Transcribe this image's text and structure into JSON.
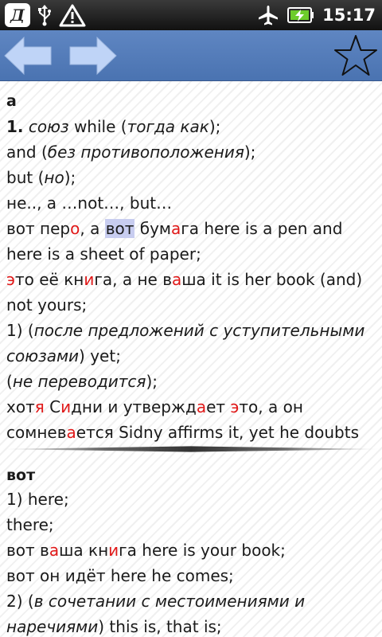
{
  "status_bar": {
    "app_badge_letter": "Д",
    "icons": [
      "usb-icon",
      "warning-icon",
      "airplane-mode-icon",
      "battery-charging-icon"
    ],
    "time": "15:17"
  },
  "toolbar": {
    "back_icon": "arrow-left-icon",
    "forward_icon": "arrow-right-icon",
    "favorite_icon": "star-outline-icon",
    "accent_color": "#4f78b6"
  },
  "article1": {
    "headword": "а",
    "lines": {
      "l1": {
        "num": "1.",
        "pos": "союз",
        "text1": "while (",
        "gloss": "тогда как",
        "text2": ");"
      },
      "l2": {
        "text1": "and (",
        "gloss": "без противоположения",
        "text2": ");"
      },
      "l3": {
        "text1": "but (",
        "gloss": "но",
        "text2": ");"
      },
      "l4": {
        "text": "не.., а …not…, but…"
      },
      "l5": {
        "a": "вот пер",
        "b": "о",
        "c": ", а ",
        "hl": "вот",
        "d": " бум",
        "e": "а",
        "f": "га here is a pen and"
      },
      "l6": {
        "text": "here is a sheet of paper;"
      },
      "l7": {
        "a": "э",
        "b": "то её кн",
        "c": "и",
        "d": "га, а не в",
        "e": "а",
        "f": "ша it is her book (and)"
      },
      "l8": {
        "text": "not yours;"
      },
      "l9": {
        "text1": "1) (",
        "gloss": "после предложений с уступительными"
      },
      "l10": {
        "gloss": "союзами",
        "text2": ") yet;"
      },
      "l11": {
        "text1": "(",
        "gloss": "не переводится",
        "text2": ");"
      },
      "l12": {
        "a": "хот",
        "b": "я",
        "c": " С",
        "d": "и",
        "e": "дни и утвержд",
        "f": "а",
        "g": "ет ",
        "h": "э",
        "i": "то, а он"
      },
      "l13": {
        "a": "сомнев",
        "b": "а",
        "c": "ется Sidny affirms it, yet he doubts"
      }
    }
  },
  "article2": {
    "headword": "вот",
    "lines": {
      "l1": {
        "text": "1) here;"
      },
      "l2": {
        "text": "there;"
      },
      "l3": {
        "a": "вот в",
        "b": "а",
        "c": "ша кн",
        "d": "и",
        "e": "га here is your book;"
      },
      "l4": {
        "text": "вот он идёт here he comes;"
      },
      "l5": {
        "text1": "2) (",
        "gloss": "в сочетании с местоимениями и"
      },
      "l6": {
        "gloss": "наречиями",
        "text2": ") this is, that is;"
      }
    }
  },
  "colors": {
    "stress_mark": "#e01818",
    "search_highlight": "#c8cdf0",
    "toolbar": "#4f78b6"
  }
}
